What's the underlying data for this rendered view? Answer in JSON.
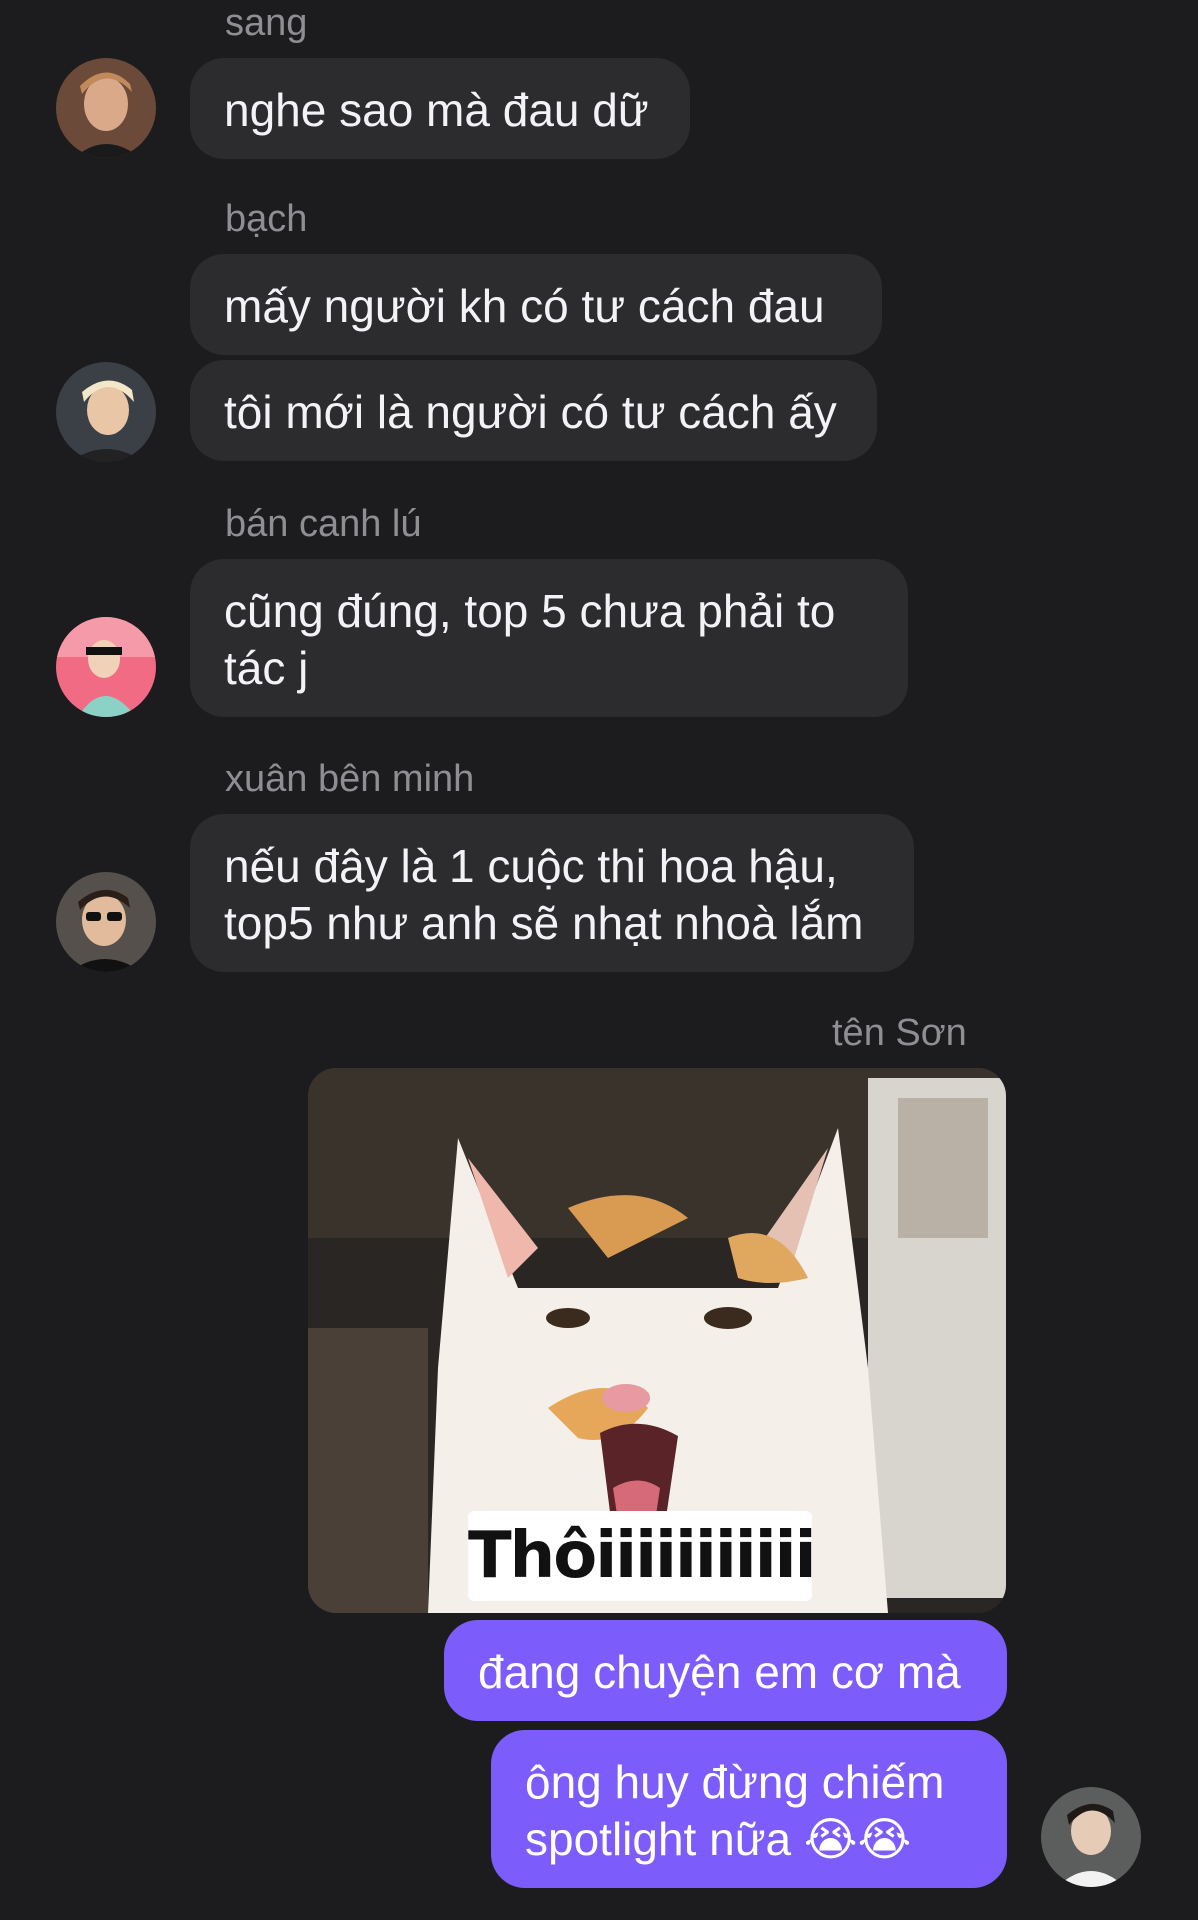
{
  "messages": [
    {
      "sender": "sang",
      "bubbles": [
        "nghe sao mà đau dữ"
      ],
      "avatar_icon": "sang-avatar-icon"
    },
    {
      "sender": "bạch",
      "bubbles": [
        "mấy người kh có tư cách đau",
        "tôi mới là người có tư cách ấy"
      ],
      "avatar_icon": "bach-avatar-icon"
    },
    {
      "sender": "bán canh lú",
      "bubbles": [
        "cũng đúng, top 5 chưa phải to\ntác j"
      ],
      "avatar_icon": "ban-canh-lu-avatar-icon"
    },
    {
      "sender": "xuân bên minh",
      "bubbles": [
        "nếu đây là 1 cuộc thi hoa hậu,\ntop5 như anh sẽ nhạt nhoà lắm"
      ],
      "avatar_icon": "xuan-ben-minh-avatar-icon"
    }
  ],
  "outgoing": {
    "sender": "tên Sơn",
    "image_caption": "Thôiiiiiiiiiii",
    "bubbles": [
      "đang chuyện em cơ mà",
      "ông huy đừng chiếm\nspotlight nữa 😭😭"
    ],
    "avatar_icon": "ten-son-avatar-icon"
  },
  "colors": {
    "background": "#1c1c1e",
    "incoming_bubble": "#2c2c2e",
    "outgoing_bubble": "#7c5cfa",
    "sender_name": "#8e8e93"
  }
}
